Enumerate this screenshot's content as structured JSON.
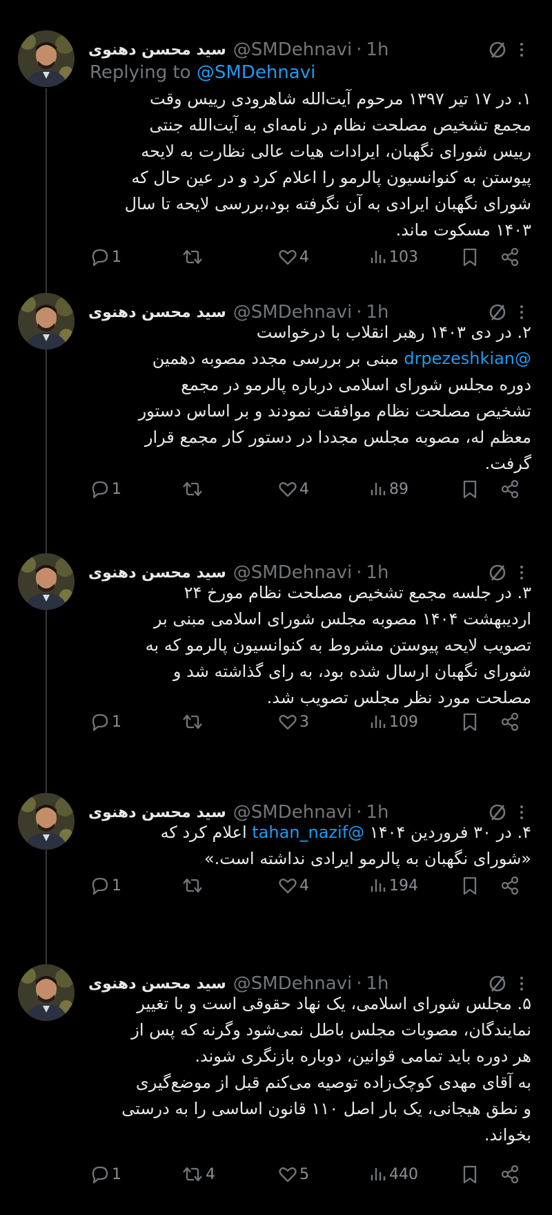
{
  "author": {
    "name": "سید محسن دهنوی",
    "handle": "@SMDehnavi",
    "dot": "·",
    "time": "1h"
  },
  "replying": {
    "prefix": "Replying to ",
    "mention": "@SMDehnavi"
  },
  "icons": {
    "reply": "reply-icon",
    "retweet": "retweet-icon",
    "like": "heart-icon",
    "views": "views-icon",
    "bookmark": "bookmark-icon",
    "share": "share-icon",
    "grok": "grok-icon",
    "more": "more-icon"
  },
  "colors": {
    "background": "#000000",
    "text": "#e7e9ea",
    "muted": "#71767b",
    "link": "#1d9bf0"
  },
  "tweets": [
    {
      "lines": [
        "۱. در ۱۷ تیر ۱۳۹۷ مرحوم آیت‌الله شاهرودی رییس وقت",
        "مجمع تشخیص مصلحت نظام در نامه‌ای به آیت‌الله جنتی",
        "رییس شورای نگهبان، ایرادات هیات عالی نظارت به لایحه",
        "پیوستن به کنوانسیون پالرمو را اعلام کرد و در عین حال که",
        "شورای نگهبان ایرادی به آن نگرفته بود،بررسی لایحه تا سال",
        "۱۴۰۳ مسکوت ماند."
      ],
      "stats": {
        "replies": "1",
        "retweets": "",
        "likes": "4",
        "views": "103"
      }
    },
    {
      "line1": "۲. در دی ۱۴۰۳ رهبر انقلاب با درخواست",
      "mention": "@drpezeshkian",
      "line2_rest": " مبنی بر بررسی مجدد مصوبه دهمین",
      "lines": [
        "دوره مجلس شورای اسلامی درباره پالرمو در مجمع",
        "تشخیص مصلحت نظام موافقت نمودند و بر اساس دستور",
        "معظم له، مصوبه مجلس مجددا در دستور کار مجمع قرار",
        "گرفت."
      ],
      "stats": {
        "replies": "1",
        "retweets": "",
        "likes": "4",
        "views": "89"
      }
    },
    {
      "lines": [
        "۳. در جلسه مجمع تشخیص مصلحت نظام مورخ ۲۴",
        "اردیبهشت ۱۴۰۴ مصوبه مجلس شورای اسلامی مبنی بر",
        "تصویب لایحه پیوستن مشروط به کنوانسیون پالرمو که به",
        "شورای نگهبان ارسال شده بود، به رای گذاشته شد و",
        "مصلحت مورد نظر مجلس تصویب شد."
      ],
      "stats": {
        "replies": "1",
        "retweets": "",
        "likes": "3",
        "views": "109"
      }
    },
    {
      "line1_pre": "۴. در ۳۰ فروردین ۱۴۰۴ ",
      "mention": "@tahan_nazif",
      "line1_post": " اعلام کرد که",
      "lines": [
        "«شورای نگهبان به پالرمو ایرادی نداشته است.»"
      ],
      "stats": {
        "replies": "1",
        "retweets": "",
        "likes": "4",
        "views": "194"
      }
    },
    {
      "lines": [
        "۵. مجلس شورای اسلامی، یک نهاد حقوقی است و با تغییر",
        "نمایندگان، مصوبات مجلس باطل نمی‌شود وگرنه که پس از",
        "هر دوره باید تمامی قوانین، دوباره بازنگری شوند.",
        "به آقای مهدی کوچک‌زاده توصیه می‌کنم قبل از موضع‌گیری",
        "و نطق هیجانی، یک بار اصل ۱۱۰ قانون اساسی را به درستی",
        "بخواند."
      ],
      "stats": {
        "replies": "1",
        "retweets": "4",
        "likes": "5",
        "views": "440"
      }
    }
  ]
}
